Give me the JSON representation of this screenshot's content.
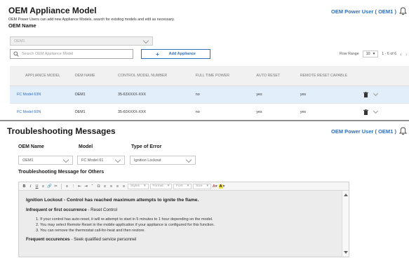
{
  "top": {
    "title": "OEM Appliance Model",
    "user": "OEM Power User ( OEM1 )",
    "description": "OEM Power Users can add new Appliance Models, search for existing models and edit as necessary.",
    "oem_name_label": "OEM Name",
    "oem_select_value": "OEM1",
    "search_placeholder": "Search OEM Appliance Model",
    "add_button": "Add Appliance",
    "pager": {
      "rows_label": "Row Range",
      "rows_value": "10",
      "range_text": "1 - 6 of 6"
    },
    "table": {
      "headers": [
        "APPLIANCE MODEL",
        "OEM NAME",
        "CONTROL MODEL NUMBER",
        "FULL TIME POWER",
        "AUTO RESET",
        "REMOTE RESET CAPABLE"
      ],
      "rows": [
        [
          "FC Model 63N",
          "OEM1",
          "35-63XXXX-XXX",
          "no",
          "yes",
          "yes"
        ],
        [
          "FC Model 60N",
          "OEM1",
          "35-60XXXX-XXX",
          "no",
          "yes",
          "yes"
        ]
      ]
    }
  },
  "bottom": {
    "title": "Troubleshooting Messages",
    "user": "OEM Power User ( OEM1 )",
    "oem_name_label": "OEM Name",
    "oem_value": "OEM1",
    "model_label": "Model",
    "model_value": "FC Model 61",
    "error_type_label": "Type of Error",
    "error_type_value": "Ignition Lockout",
    "message_label": "Troubleshooting Message for Others",
    "toolbar": {
      "styles": "Styles",
      "format": "Format",
      "font": "Font",
      "size": "Size"
    },
    "editor": {
      "heading": "Ignition Lockout - Control has reached maximum attempts to ignite the flame.",
      "sub1_bold": "Infrequent or first occurrence",
      "sub1_rest": " - Reset Control",
      "items": [
        "1. If your control has auto-reset, it will re-attempt to start in 5 minutes to 1 hour depending on the model.",
        "2. You may select Remote Reset in the mobile application if your appliance is configured for this function.",
        "3. You can remove the thermostat call-for-heat and then restore."
      ],
      "sub2_bold": "Frequent occurences",
      "sub2_rest": " - Seek qualified service personnel"
    }
  }
}
